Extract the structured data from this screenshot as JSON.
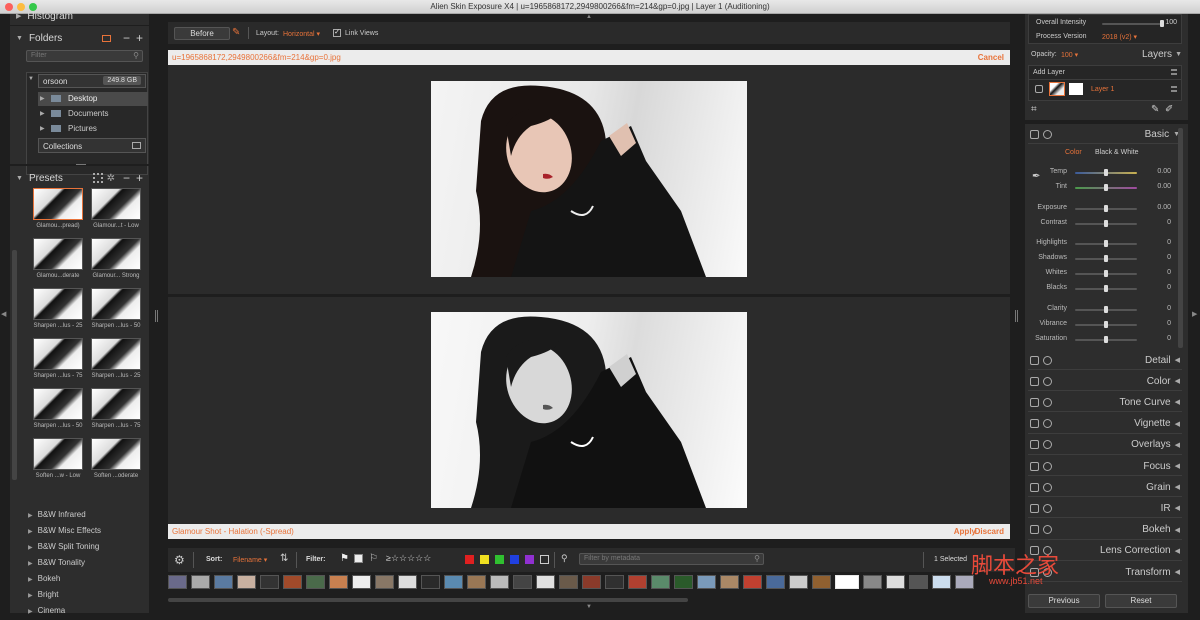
{
  "window": {
    "title": "Alien Skin Exposure X4 | u=1965868172,2949800266&fm=214&gp=0.jpg | Layer 1 (Auditioning)"
  },
  "left": {
    "histogram": "Histogram",
    "folders": {
      "title": "Folders",
      "filter_placeholder": "Filter",
      "drive": "orsoon",
      "drive_size": "249.8 GB",
      "items": [
        "Desktop",
        "Documents",
        "Pictures"
      ],
      "collections": "Collections"
    },
    "presets": {
      "title": "Presets",
      "items": [
        "Glamou...pread)",
        "Glamour...t - Low",
        "Glamou...derate",
        "Glamour... Strong",
        "Sharpen ...lus - 25",
        "Sharpen ...lus - 50",
        "Sharpen ...lus - 75",
        "Sharpen ...lus - 25",
        "Sharpen ...lus - 50",
        "Sharpen ...lus - 75",
        "Soften ...w - Low",
        "Soften ...oderate"
      ],
      "categories": [
        "B&W Infrared",
        "B&W Misc Effects",
        "B&W Split Toning",
        "B&W Tonality",
        "Bokeh",
        "Bright",
        "Cinema"
      ]
    }
  },
  "center": {
    "before_btn": "Before",
    "layout_label": "Layout:",
    "layout_value": "Horizontal",
    "link_views": "Link Views",
    "filename": "u=1965868172,2949800266&fm=214&gp=0.jpg",
    "cancel": "Cancel",
    "preset_name": "Glamour Shot - Halation (-Spread)",
    "apply": "Apply",
    "discard": "Discard",
    "sort_label": "Sort:",
    "sort_value": "Filename",
    "filter_label": "Filter:",
    "metadata_placeholder": "Filter by metadata",
    "selected": "1 Selected"
  },
  "right": {
    "overall_intensity": "Overall Intensity",
    "overall_intensity_val": "100",
    "process_version": "Process Version",
    "process_version_val": "2018 (v2)",
    "opacity_label": "Opacity:",
    "opacity_val": "100",
    "layers": "Layers",
    "add_layer": "Add Layer",
    "layer1": "Layer 1",
    "basic": "Basic",
    "color_tab": "Color",
    "bw_tab": "Black & White",
    "sliders": [
      {
        "label": "Temp",
        "val": "0.00",
        "pos": 0.5
      },
      {
        "label": "Tint",
        "val": "0.00",
        "pos": 0.5
      },
      {
        "label": "Exposure",
        "val": "0.00",
        "pos": 0.5
      },
      {
        "label": "Contrast",
        "val": "0",
        "pos": 0.5
      },
      {
        "label": "Highlights",
        "val": "0",
        "pos": 0.5
      },
      {
        "label": "Shadows",
        "val": "0",
        "pos": 0.5
      },
      {
        "label": "Whites",
        "val": "0",
        "pos": 0.5
      },
      {
        "label": "Blacks",
        "val": "0",
        "pos": 0.5
      },
      {
        "label": "Clarity",
        "val": "0",
        "pos": 0.5
      },
      {
        "label": "Vibrance",
        "val": "0",
        "pos": 0.5
      },
      {
        "label": "Saturation",
        "val": "0",
        "pos": 0.5
      }
    ],
    "sections": [
      "Detail",
      "Color",
      "Tone Curve",
      "Vignette",
      "Overlays",
      "Focus",
      "Grain",
      "IR",
      "Bokeh",
      "Lens Correction",
      "Transform"
    ],
    "previous": "Previous",
    "reset": "Reset"
  },
  "watermark": {
    "text": "脚本之家",
    "url": "www.jb51.net"
  },
  "colors": {
    "accent": "#e8733a",
    "panel": "#2d2d2d",
    "bg": "#1e1e1e"
  }
}
